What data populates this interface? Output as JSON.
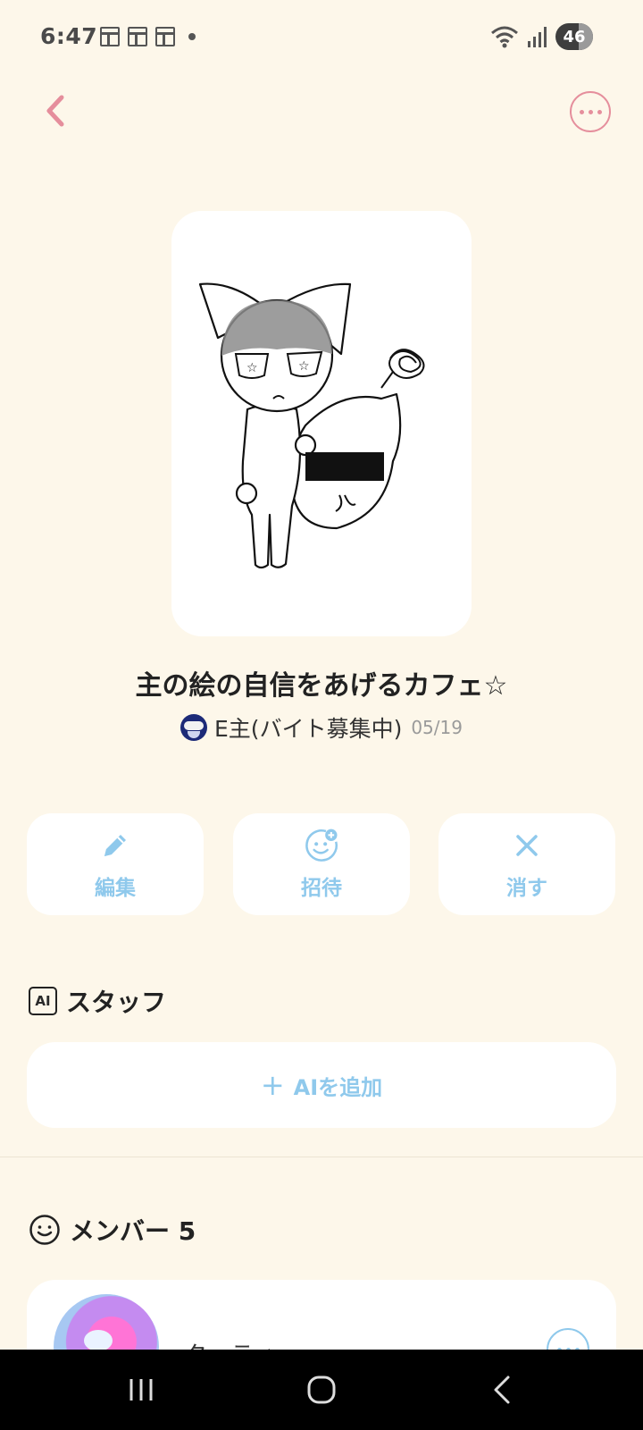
{
  "status_bar": {
    "time": "6:47",
    "battery": "46",
    "icons": [
      "notification-icon",
      "notification-icon",
      "notification-icon",
      "dot-icon",
      "wifi-icon",
      "signal-icon",
      "battery-icon"
    ]
  },
  "header": {
    "back_icon": "chevron-left-icon",
    "more_icon": "more-circle-icon"
  },
  "cafe": {
    "title": "主の絵の自信をあげるカフェ☆",
    "owner_name": "E主(バイト募集中)",
    "date": "05/19"
  },
  "actions": [
    {
      "label": "編集",
      "icon": "pencil-icon"
    },
    {
      "label": "招待",
      "icon": "invite-face-icon"
    },
    {
      "label": "消す",
      "icon": "close-icon"
    }
  ],
  "staff_section": {
    "title": "スタッフ",
    "badge": "AI",
    "add_label": "AIを追加"
  },
  "members_section": {
    "title": "メンバー 5",
    "members": [
      {
        "name": "タッティー"
      }
    ]
  },
  "colors": {
    "background": "#fdf7ea",
    "accent_pink": "#e58e9c",
    "accent_blue": "#8fc9ec",
    "card": "#ffffff"
  }
}
